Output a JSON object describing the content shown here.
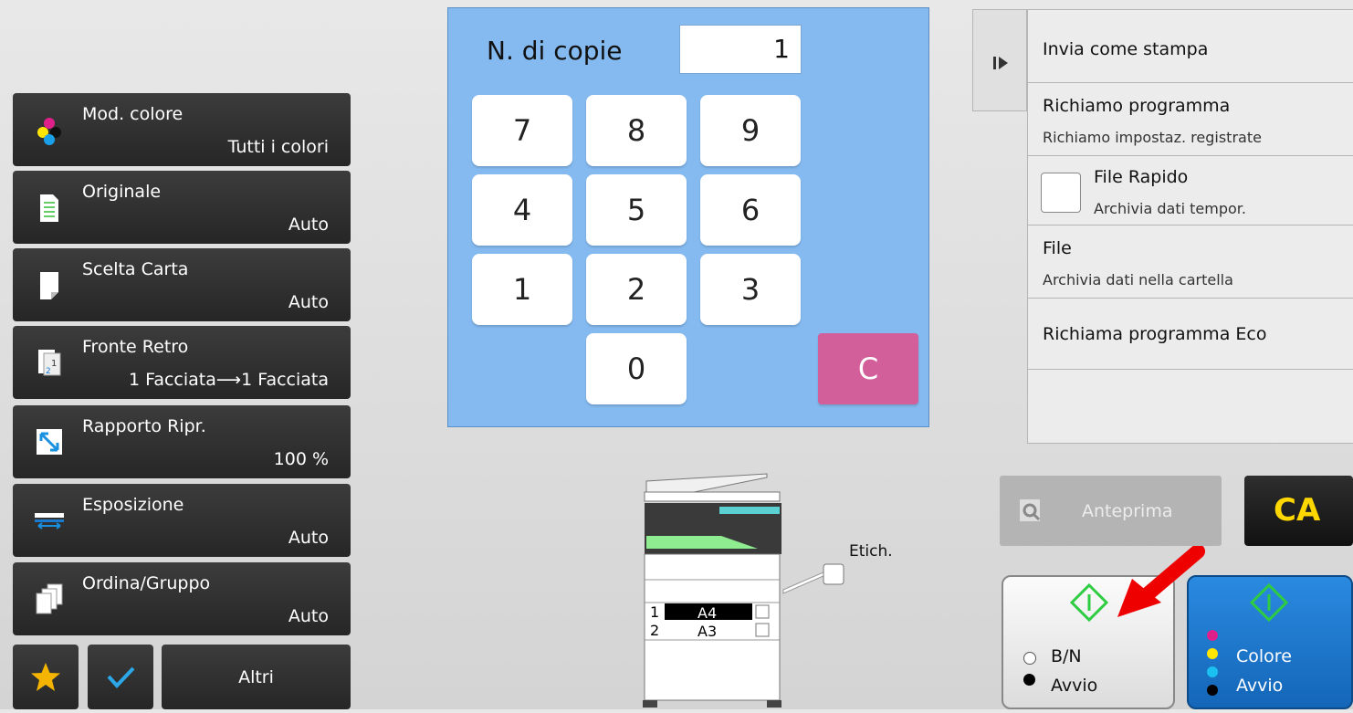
{
  "copies": {
    "label": "N. di copie",
    "value": "1"
  },
  "keypad": {
    "keys": [
      "7",
      "8",
      "9",
      "4",
      "5",
      "6",
      "1",
      "2",
      "3",
      "0"
    ],
    "clear": "C"
  },
  "functions": [
    {
      "label": "Mod. colore",
      "value": "Tutti i colori",
      "icon": "color-mode-icon"
    },
    {
      "label": "Originale",
      "value": "Auto",
      "icon": "original-document-icon"
    },
    {
      "label": "Scelta Carta",
      "value": "Auto",
      "icon": "paper-select-icon"
    },
    {
      "label": "Fronte Retro",
      "value": "1 Facciata⟶1 Facciata",
      "icon": "duplex-icon"
    },
    {
      "label": "Rapporto Ripr.",
      "value": "100 %",
      "icon": "ratio-icon"
    },
    {
      "label": "Esposizione",
      "value": "Auto",
      "icon": "exposure-icon"
    },
    {
      "label": "Ordina/Gruppo",
      "value": "Auto",
      "icon": "sort-group-icon"
    }
  ],
  "bottom": {
    "others_label": "Altri"
  },
  "right_panel": {
    "send_as_print": "Invia come stampa",
    "recall_program": {
      "title": "Richiamo programma",
      "sub": "Richiamo impostaz. registrate"
    },
    "quick_file": {
      "title": "File Rapido",
      "sub": "Archivia dati tempor."
    },
    "file": {
      "title": "File",
      "sub": "Archivia dati nella cartella"
    },
    "eco": {
      "title": "Richiama programma Eco"
    }
  },
  "preview_label": "Anteprima",
  "ca_label": "CA",
  "machine": {
    "label_tag": "Etich.",
    "trays": [
      {
        "num": "1",
        "size": "A4"
      },
      {
        "num": "2",
        "size": "A3"
      }
    ]
  },
  "start_bw": {
    "line1": "B/N",
    "line2": "Avvio"
  },
  "start_color": {
    "line1": "Colore",
    "line2": "Avvio"
  },
  "colors": {
    "keypad_bg": "#85baf0",
    "clear_key": "#d35f9a",
    "color_start": "#1a7ad0",
    "ca_text": "#ffd700",
    "start_icon": "#2ecc40",
    "arrow": "#ee0000"
  }
}
